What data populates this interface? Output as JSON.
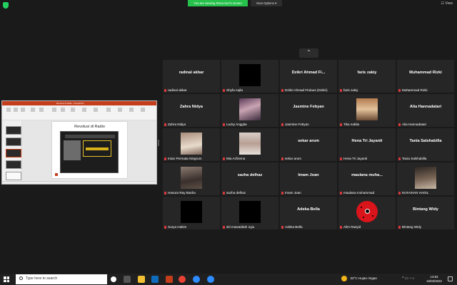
{
  "topbar": {
    "banner": "You are viewing Rena Suri's screen",
    "view_options": "View Options",
    "view_options_caret": "▾",
    "view_label": "View"
  },
  "grid_nav": {
    "up_arrow": "⌃"
  },
  "participants": [
    {
      "big": "radinal akbar",
      "label": "radinal akbar",
      "type": "name"
    },
    {
      "big": "",
      "label": "Shyfa Aqila",
      "type": "black"
    },
    {
      "big": "Dzikri Ahmad Fi...",
      "label": "Dzikri Ahmad Firdaus (Dzikri)",
      "type": "name"
    },
    {
      "big": "faris zakiy",
      "label": "faris zakiy",
      "type": "name"
    },
    {
      "big": "Muhammad Rizki",
      "label": "Muhammad Rizki",
      "type": "name"
    },
    {
      "big": "Zahra Nidya",
      "label": "Zahra Nidya",
      "type": "name"
    },
    {
      "big": "",
      "label": "Lucky Anggita",
      "type": "photo1"
    },
    {
      "big": "Jasmine Febyan",
      "label": "Jasmine Febyan",
      "type": "name"
    },
    {
      "big": "",
      "label": "Tika nabila",
      "type": "photo2"
    },
    {
      "big": "Alia Hannadatari",
      "label": "Alia Hannadatari",
      "type": "name"
    },
    {
      "big": "",
      "label": "Intan Permata Ningrum",
      "type": "photo3"
    },
    {
      "big": "",
      "label": "Mia Azhiema",
      "type": "photo4"
    },
    {
      "big": "sekar arum",
      "label": "sekar arum",
      "type": "name"
    },
    {
      "big": "Hena Tri Jayanti",
      "label": "Hena Tri Jayanti",
      "type": "name"
    },
    {
      "big": "Tania Salshabilla",
      "label": "Tania Salshabilla",
      "type": "name"
    },
    {
      "big": "",
      "label": "Hanura Ray Basha",
      "type": "photo5"
    },
    {
      "big": "sazha delhaz",
      "label": "sazha delhaz",
      "type": "name"
    },
    {
      "big": "Imam Joan",
      "label": "Imam Joan",
      "type": "name"
    },
    {
      "big": "maulana muha...",
      "label": "maulana muhammad",
      "type": "name"
    },
    {
      "big": "",
      "label": "M.RAIHAN HADIL",
      "type": "photo6"
    },
    {
      "big": "",
      "label": "Surya Hakim",
      "type": "black"
    },
    {
      "big": "",
      "label": "siti mawaddah ngiu",
      "type": "black"
    },
    {
      "big": "Adeka Bella",
      "label": "Adeka Bella",
      "type": "name"
    },
    {
      "big": "",
      "label": "Alim Rasyid",
      "type": "logo"
    },
    {
      "big": "Bintang Widy",
      "label": "Bintang Widy",
      "type": "name"
    }
  ],
  "shared_screen": {
    "app_title": "Revolusi di Radio - PowerPoint",
    "slide_title": "Revolusi di Radio"
  },
  "taskbar": {
    "search_placeholder": "Type here to search",
    "temperature": "32°C",
    "weather": "Hujan ringan",
    "time": "13:53",
    "date": "16/03/2022"
  },
  "colors": {
    "banner_green": "#27c24c",
    "ppt_red": "#c43e1c",
    "muted_mic": "#e0393e",
    "tile_bg": "#262626"
  }
}
